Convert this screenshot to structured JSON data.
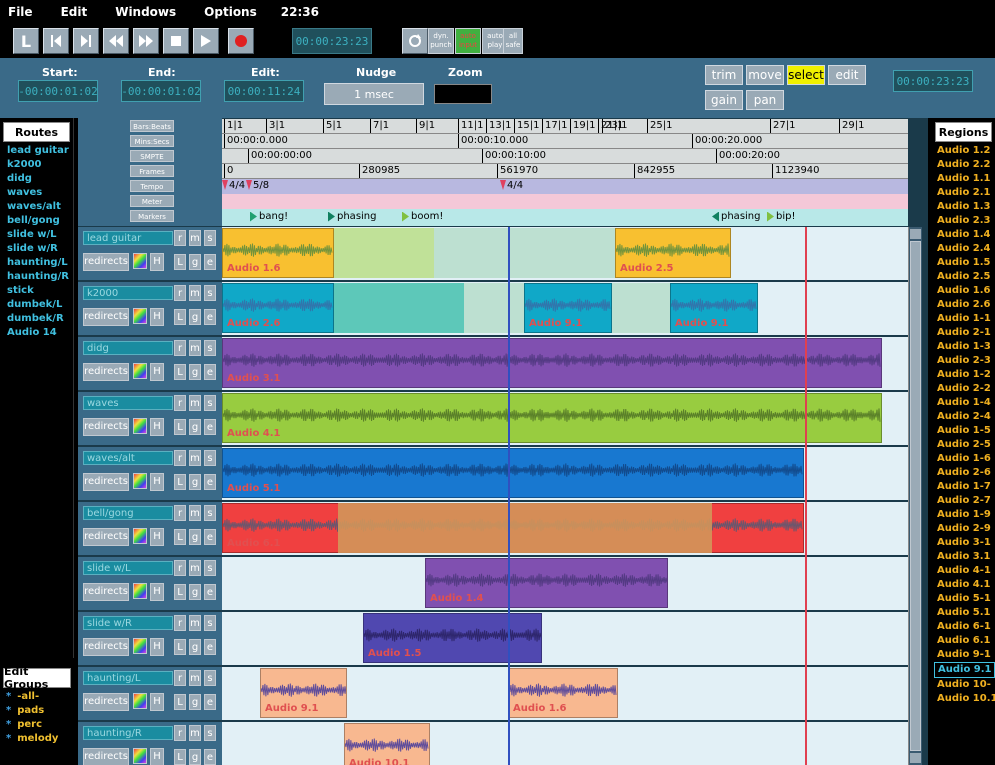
{
  "menu": {
    "items": [
      "File",
      "Edit",
      "Windows",
      "Options"
    ],
    "clock": "22:36"
  },
  "transport": {
    "buttons": [
      "L",
      "start",
      "end",
      "rewind",
      "forward",
      "stop",
      "play",
      "record"
    ],
    "clock": "00:00:23:23",
    "dyn_punch": "dyn. punch",
    "auto_input": "auto input",
    "auto_play": "auto play",
    "all_safe": "all safe"
  },
  "toolbar": {
    "start_label": "Start:",
    "start_value": "-00:00:01:02",
    "end_label": "End:",
    "end_value": "-00:00:01:02",
    "edit_label": "Edit:",
    "edit_value": "00:00:11:24",
    "nudge_label": "Nudge",
    "nudge_value": "1 msec",
    "zoom_label": "Zoom",
    "modes": [
      "trim",
      "move",
      "select",
      "edit",
      "gain",
      "pan"
    ],
    "selected_mode": "select",
    "clock2": "00:00:23:23"
  },
  "routes": {
    "title": "Routes",
    "items": [
      "lead guitar",
      "k2000",
      "didg",
      "waves",
      "waves/alt",
      "bell/gong",
      "slide w/L",
      "slide w/R",
      "haunting/L",
      "haunting/R",
      "stick",
      "dumbek/L",
      "dumbek/R",
      "Audio 14"
    ]
  },
  "edit_groups": {
    "title": "Edit Groups",
    "items": [
      "-all-",
      "pads",
      "perc",
      "melody"
    ]
  },
  "regions": {
    "title": "Regions",
    "items": [
      "Audio 1.2",
      "Audio 2.2",
      "Audio 1.1",
      "Audio 2.1",
      "Audio 1.3",
      "Audio 2.3",
      "Audio 1.4",
      "Audio 2.4",
      "Audio 1.5",
      "Audio 2.5",
      "Audio 1.6",
      "Audio 2.6",
      "Audio 1-1",
      "Audio 2-1",
      "Audio 1-3",
      "Audio 2-3",
      "Audio 1-2",
      "Audio 2-2",
      "Audio 1-4",
      "Audio 2-4",
      "Audio 1-5",
      "Audio 2-5",
      "Audio 1-6",
      "Audio 2-6",
      "Audio 1-7",
      "Audio 2-7",
      "Audio 1-9",
      "Audio 2-9",
      "Audio 3-1",
      "Audio 3.1",
      "Audio 4-1",
      "Audio 4.1",
      "Audio 5-1",
      "Audio 5.1",
      "Audio 6-1",
      "Audio 6.1",
      "Audio 9-1",
      "Audio 9.1",
      "Audio 10-",
      "Audio 10.1"
    ],
    "selected": "Audio 9.1"
  },
  "rulers": {
    "labels": [
      "Bars:Beats",
      "Mins:Secs",
      "SMPTE",
      "Frames",
      "Tempo",
      "Meter",
      "Markers"
    ],
    "bars": [
      "1|1",
      "3|1",
      "5|1",
      "7|1",
      "9|1",
      "11|1",
      "13|1",
      "15|1",
      "17|1",
      "19|1",
      "21|1",
      "23|1",
      "25|1",
      "27|1",
      "29|1"
    ],
    "mins": [
      "00:00:0.000",
      "00:00:10.000",
      "00:00:20.000"
    ],
    "smpte": [
      "00:00:00:00",
      "00:00:10:00",
      "00:00:20:00"
    ],
    "frames": [
      "0",
      "280985",
      "561970",
      "842955",
      "1123940"
    ],
    "tempo": [
      "4/4",
      "5/8",
      "4/4"
    ],
    "markers": [
      "bang!",
      "phasing",
      "boom!",
      "phasing",
      "bip!"
    ]
  },
  "tracks": [
    {
      "name": "lead guitar",
      "regions": [
        "Audio 1.6",
        "Audio 2.5"
      ]
    },
    {
      "name": "k2000",
      "regions": [
        "Audio 2.6",
        "Audio 9.1",
        "Audio 9.1"
      ]
    },
    {
      "name": "didg",
      "regions": [
        "Audio 3.1"
      ]
    },
    {
      "name": "waves",
      "regions": [
        "Audio 4.1"
      ]
    },
    {
      "name": "waves/alt",
      "regions": [
        "Audio 5.1"
      ]
    },
    {
      "name": "bell/gong",
      "regions": [
        "Audio 6.1"
      ]
    },
    {
      "name": "slide w/L",
      "regions": [
        "Audio 1.4"
      ]
    },
    {
      "name": "slide w/R",
      "regions": [
        "Audio 1.5"
      ]
    },
    {
      "name": "haunting/L",
      "regions": [
        "Audio 9.1",
        "Audio 1.6"
      ]
    },
    {
      "name": "haunting/R",
      "regions": [
        "Audio 10.1"
      ]
    }
  ],
  "track_buttons": {
    "r": "r",
    "m": "m",
    "s": "s",
    "L": "L",
    "g": "g",
    "e": "e",
    "redirects": "redirects",
    "H": "H"
  }
}
